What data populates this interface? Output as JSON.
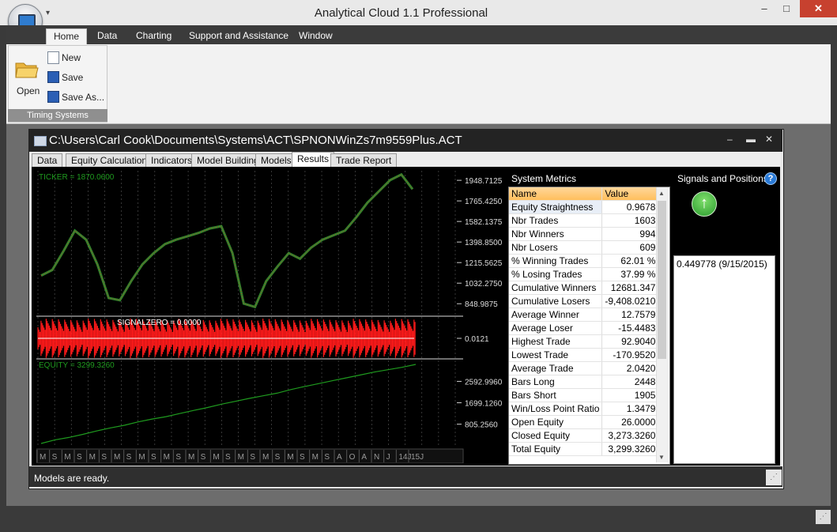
{
  "app": {
    "title": "Analytical Cloud 1.1 Professional",
    "qat_icon": "dropdown-arrow"
  },
  "window_buttons": {
    "minimize": "–",
    "maximize": "□",
    "close": "✕"
  },
  "ribbon": {
    "tabs": [
      "Home",
      "Data",
      "Charting",
      "Support and Assistance",
      "Window"
    ],
    "active_tab": "Home",
    "group": {
      "label": "Timing Systems",
      "open": "Open",
      "new": "New",
      "save": "Save",
      "save_as": "Save As..."
    }
  },
  "child_window": {
    "path": "C:\\Users\\Carl Cook\\Documents\\Systems\\ACT\\SPNONWinZs7m9559Plus.ACT",
    "buttons": {
      "minimize": "–",
      "maximize": "▬",
      "close": "✕"
    },
    "tabs": [
      "Data",
      "Equity Calculations",
      "Indicators",
      "Model Building",
      "Models",
      "Results",
      "Trade Report"
    ],
    "active_tab": "Results"
  },
  "chart_data": {
    "type": "line",
    "panels": [
      {
        "name": "TICKER",
        "label": "TICKER = 1870.0600",
        "ticks": [
          "1948.7125",
          "1765.4250",
          "1582.1375",
          "1398.8500",
          "1215.5625",
          "1032.2750",
          "848.9875"
        ],
        "values": [
          1100,
          1150,
          1320,
          1500,
          1420,
          1200,
          900,
          880,
          1050,
          1200,
          1300,
          1380,
          1420,
          1450,
          1480,
          1520,
          1540,
          1300,
          850,
          820,
          1050,
          1180,
          1300,
          1250,
          1350,
          1420,
          1460,
          1500,
          1620,
          1750,
          1850,
          1950,
          2000,
          1870
        ]
      },
      {
        "name": "SIGNAL",
        "label": "SIGNALZERO = 0.0000",
        "ticks": [
          "0.0121"
        ]
      },
      {
        "name": "EQUITY",
        "label": "EQUITY = 3299.3260",
        "ticks": [
          "2592.9960",
          "1699.1260",
          "805.2560"
        ],
        "values": [
          0,
          150,
          250,
          380,
          520,
          650,
          760,
          900,
          1020,
          1120,
          1250,
          1380,
          1500,
          1640,
          1760,
          1880,
          1990,
          2100,
          2250,
          2380,
          2500,
          2620,
          2740,
          2860,
          2980,
          3080,
          3180,
          3300
        ]
      }
    ],
    "x_ticks": [
      "M",
      "S",
      "M",
      "S",
      "M",
      "S",
      "M",
      "S",
      "M",
      "S",
      "M",
      "S",
      "M",
      "S",
      "M",
      "S",
      "M",
      "S",
      "M",
      "S",
      "M",
      "S",
      "M",
      "S",
      "A",
      "O",
      "A",
      "N",
      "J",
      "14J",
      "15J"
    ],
    "colors": {
      "price_line": "#2e8b2e",
      "price_down": "#c22020",
      "signal": "#ff1a1a",
      "equity": "#1f9b1f",
      "grid": "#5a5a5a"
    }
  },
  "metrics": {
    "title": "System Metrics",
    "columns": [
      "Name",
      "Value"
    ],
    "rows": [
      [
        "Equity Straightness",
        "0.9678"
      ],
      [
        "Nbr Trades",
        "1603"
      ],
      [
        "Nbr Winners",
        "994"
      ],
      [
        "Nbr Losers",
        "609"
      ],
      [
        "% Winning Trades",
        "62.01 %"
      ],
      [
        "% Losing Trades",
        "37.99 %"
      ],
      [
        "Cumulative Winners",
        "12681.347"
      ],
      [
        "Cumulative Losers",
        "-9,408.0210"
      ],
      [
        "Average Winner",
        "12.7579"
      ],
      [
        "Average Loser",
        "-15.4483"
      ],
      [
        "Highest Trade",
        "92.9040"
      ],
      [
        "Lowest Trade",
        "-170.9520"
      ],
      [
        "Average Trade",
        "2.0420"
      ],
      [
        "Bars Long",
        "2448"
      ],
      [
        "Bars Short",
        "1905"
      ],
      [
        "Win/Loss Point Ratio",
        "1.3479"
      ],
      [
        "Open Equity",
        "26.0000"
      ],
      [
        "Closed Equity",
        "3,273.3260"
      ],
      [
        "Total Equity",
        "3,299.3260"
      ]
    ]
  },
  "signals": {
    "title": "Signals and Positions",
    "help": "?",
    "direction_icon": "up-arrow",
    "entry": "0.449778 (9/15/2015)"
  },
  "status": {
    "text": "Models are ready."
  }
}
